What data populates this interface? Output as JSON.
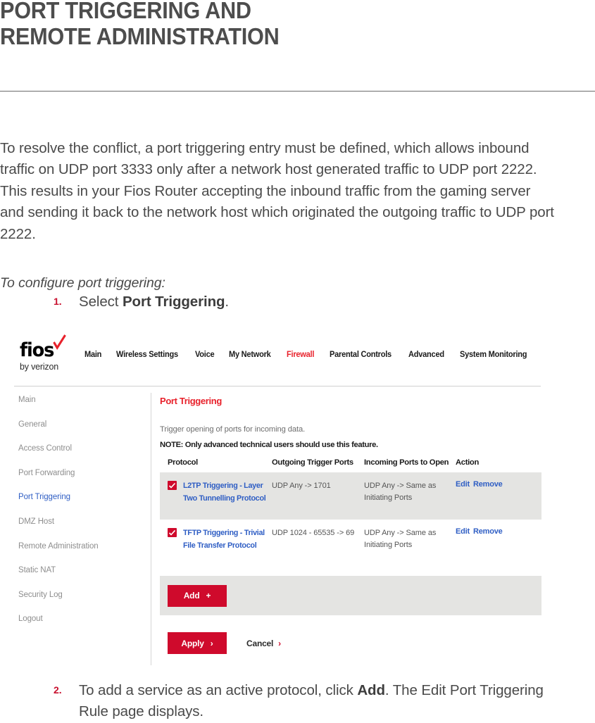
{
  "document": {
    "title_line1": "PORT TRIGGERING AND",
    "title_line2": "REMOTE ADMINISTRATION",
    "intro_paragraph": "To resolve the conflict, a port triggering entry must be defined, which allows inbound traffic on UDP port 3333 only after a network host generated traffic to UDP port 2222. This results in your Fios Router accepting the inbound traffic from the gaming server and sending it back to the network host which originated the outgoing traffic to UDP port 2222.",
    "configure_lead": "To configure port triggering:",
    "steps": [
      {
        "number": "1.",
        "text_before": "Select ",
        "bold": "Port Triggering",
        "text_after": "."
      },
      {
        "number": "2.",
        "text_before": "To add a service as an active protocol, click ",
        "bold": "Add",
        "text_after": ". The Edit Port Triggering Rule page displays."
      }
    ],
    "accent_color": "#c8102e"
  },
  "router_ui": {
    "logo": {
      "wordmark": "fios",
      "tagline": "by verizon",
      "check_icon": "check-icon",
      "check_color": "#e8212b"
    },
    "top_nav": [
      {
        "label": "Main",
        "active": false
      },
      {
        "label": "Wireless Settings",
        "active": false
      },
      {
        "label": "Voice",
        "active": false
      },
      {
        "label": "My Network",
        "active": false
      },
      {
        "label": "Firewall",
        "active": true
      },
      {
        "label": "Parental Controls",
        "active": false
      },
      {
        "label": "Advanced",
        "active": false
      },
      {
        "label": "System Monitoring",
        "active": false
      }
    ],
    "sidebar": [
      {
        "label": "Main",
        "active": false
      },
      {
        "label": "General",
        "active": false
      },
      {
        "label": "Access Control",
        "active": false
      },
      {
        "label": "Port Forwarding",
        "active": false
      },
      {
        "label": "Port Triggering",
        "active": true
      },
      {
        "label": "DMZ Host",
        "active": false
      },
      {
        "label": "Remote Administration",
        "active": false
      },
      {
        "label": "Static NAT",
        "active": false
      },
      {
        "label": "Security Log",
        "active": false
      },
      {
        "label": "Logout",
        "active": false
      }
    ],
    "panel": {
      "title": "Port Triggering",
      "description": "Trigger opening of ports for incoming data.",
      "note": "NOTE: Only advanced technical users should use this feature.",
      "columns": {
        "protocol": "Protocol",
        "outgoing": "Outgoing Trigger Ports",
        "incoming": "Incoming Ports to Open",
        "action": "Action"
      },
      "rows": [
        {
          "checked": true,
          "protocol": "L2TP Triggering - Layer Two Tunnelling Protocol",
          "outgoing": "UDP Any -> 1701",
          "incoming": "UDP Any -> Same as Initiating Ports",
          "edit_label": "Edit",
          "remove_label": "Remove",
          "shaded": true
        },
        {
          "checked": true,
          "protocol": "TFTP Triggering - Trivial File Transfer Protocol",
          "outgoing": "UDP 1024 - 65535 -> 69",
          "incoming": "UDP Any -> Same as Initiating Ports",
          "edit_label": "Edit",
          "remove_label": "Remove",
          "shaded": false
        }
      ],
      "add_button": "Add",
      "add_icon": "plus-icon",
      "apply_button": "Apply",
      "apply_icon": "chevron-right-icon",
      "cancel_button": "Cancel",
      "cancel_icon": "chevron-right-icon",
      "button_color": "#cf0a2c",
      "link_color": "#2f5ec4"
    }
  }
}
